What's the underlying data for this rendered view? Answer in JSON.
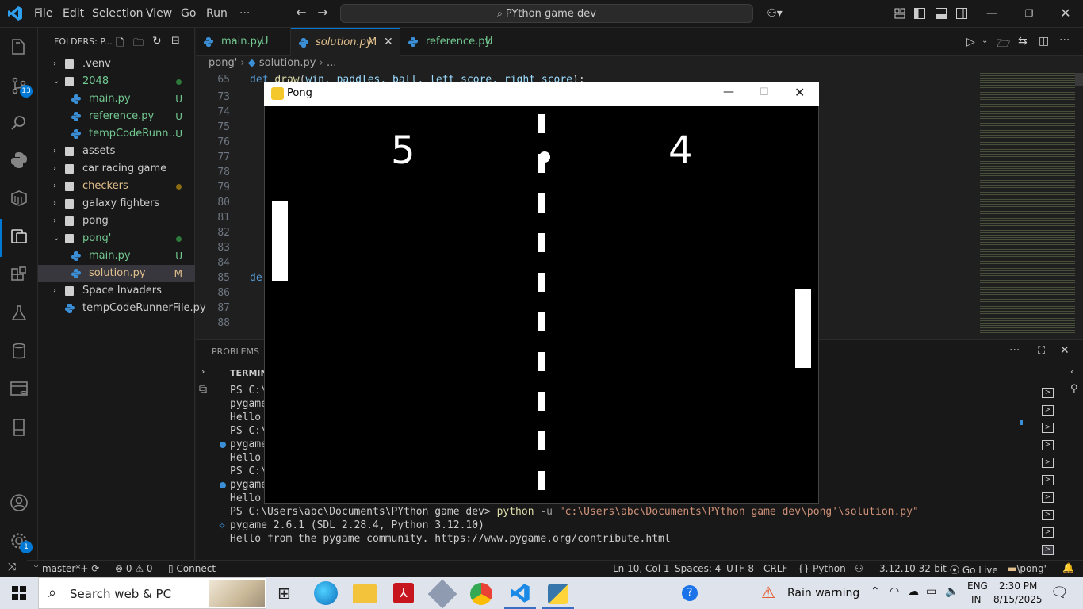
{
  "titlebar": {
    "menu": [
      "File",
      "Edit",
      "Selection",
      "View",
      "Go",
      "Run",
      "···"
    ],
    "search": "PYthon game dev"
  },
  "activitybar": {
    "source_control_badge": "13",
    "settings_badge": "1"
  },
  "sidebar": {
    "header": "FOLDERS: P...",
    "items": [
      {
        "label": ".venv",
        "status": ""
      },
      {
        "label": "2048",
        "status": ""
      },
      {
        "label": "main.py",
        "status": "U"
      },
      {
        "label": "reference.py",
        "status": "U"
      },
      {
        "label": "tempCodeRunn...",
        "status": "U"
      },
      {
        "label": "assets",
        "status": ""
      },
      {
        "label": "car racing game",
        "status": ""
      },
      {
        "label": "checkers",
        "status": ""
      },
      {
        "label": "galaxy fighters",
        "status": ""
      },
      {
        "label": "pong",
        "status": ""
      },
      {
        "label": "pong'",
        "status": ""
      },
      {
        "label": "main.py",
        "status": "U"
      },
      {
        "label": "solution.py",
        "status": "M"
      },
      {
        "label": "Space Invaders",
        "status": ""
      },
      {
        "label": "tempCodeRunnerFile.py",
        "status": ""
      }
    ]
  },
  "editor": {
    "tabs": [
      {
        "label": "main.py",
        "status": "U"
      },
      {
        "label": "solution.py",
        "status": "M"
      },
      {
        "label": "reference.py",
        "status": "U"
      }
    ],
    "breadcrumb": [
      "pong'",
      "solution.py",
      "..."
    ],
    "line_numbers": [
      "65",
      "73",
      "74",
      "75",
      "76",
      "77",
      "78",
      "79",
      "80",
      "81",
      "82",
      "83",
      "84",
      "85",
      "86",
      "87",
      "88"
    ],
    "line65_code": "def draw(win, paddles, ball, left_score, right_score):",
    "line85_code": "de"
  },
  "panel": {
    "problems_tab": "PROBLEMS",
    "terminal_header": "TERMIN",
    "left_lines": [
      "PS C:\\",
      "pygame",
      "Hello",
      "PS C:\\",
      "pygame",
      "Hello",
      "PS C:\\",
      "pygame",
      "Hello"
    ],
    "cmd_prompt": "PS C:\\Users\\abc\\Documents\\PYthon game dev>",
    "cmd_python": "python",
    "cmd_flag": "-u",
    "cmd_path": "\"c:\\Users\\abc\\Documents\\PYthon game dev\\pong'\\solution.py\"",
    "line_pygame": "pygame 2.6.1 (SDL 2.28.4, Python 3.12.10)",
    "line_hello": "Hello from the pygame community. https://www.pygame.org/contribute.html"
  },
  "pong": {
    "title": "Pong",
    "left_score": "5",
    "right_score": "4"
  },
  "statusbar": {
    "branch": "master*+",
    "errors": "0",
    "warnings": "0",
    "connect": "Connect",
    "position": "Ln 10, Col 1",
    "spaces": "Spaces: 4",
    "encoding": "UTF-8",
    "eol": "CRLF",
    "language": "Python",
    "interpreter": "3.12.10 32-bit",
    "golive": "Go Live",
    "folder": "\\pong'"
  },
  "taskbar": {
    "search_placeholder": "Search web & PC",
    "weather": "Rain warning",
    "lang1": "ENG",
    "lang2": "IN",
    "time": "2:30 PM",
    "date": "8/15/2025"
  },
  "colors": {
    "accent": "#0078d4",
    "untracked": "#73c991",
    "modified": "#e2c08d",
    "keyword": "#569cd6",
    "function": "#dcdcaa",
    "param": "#9cdcfe",
    "python_cmd": "#dcdcaa",
    "string": "#ce9178"
  }
}
